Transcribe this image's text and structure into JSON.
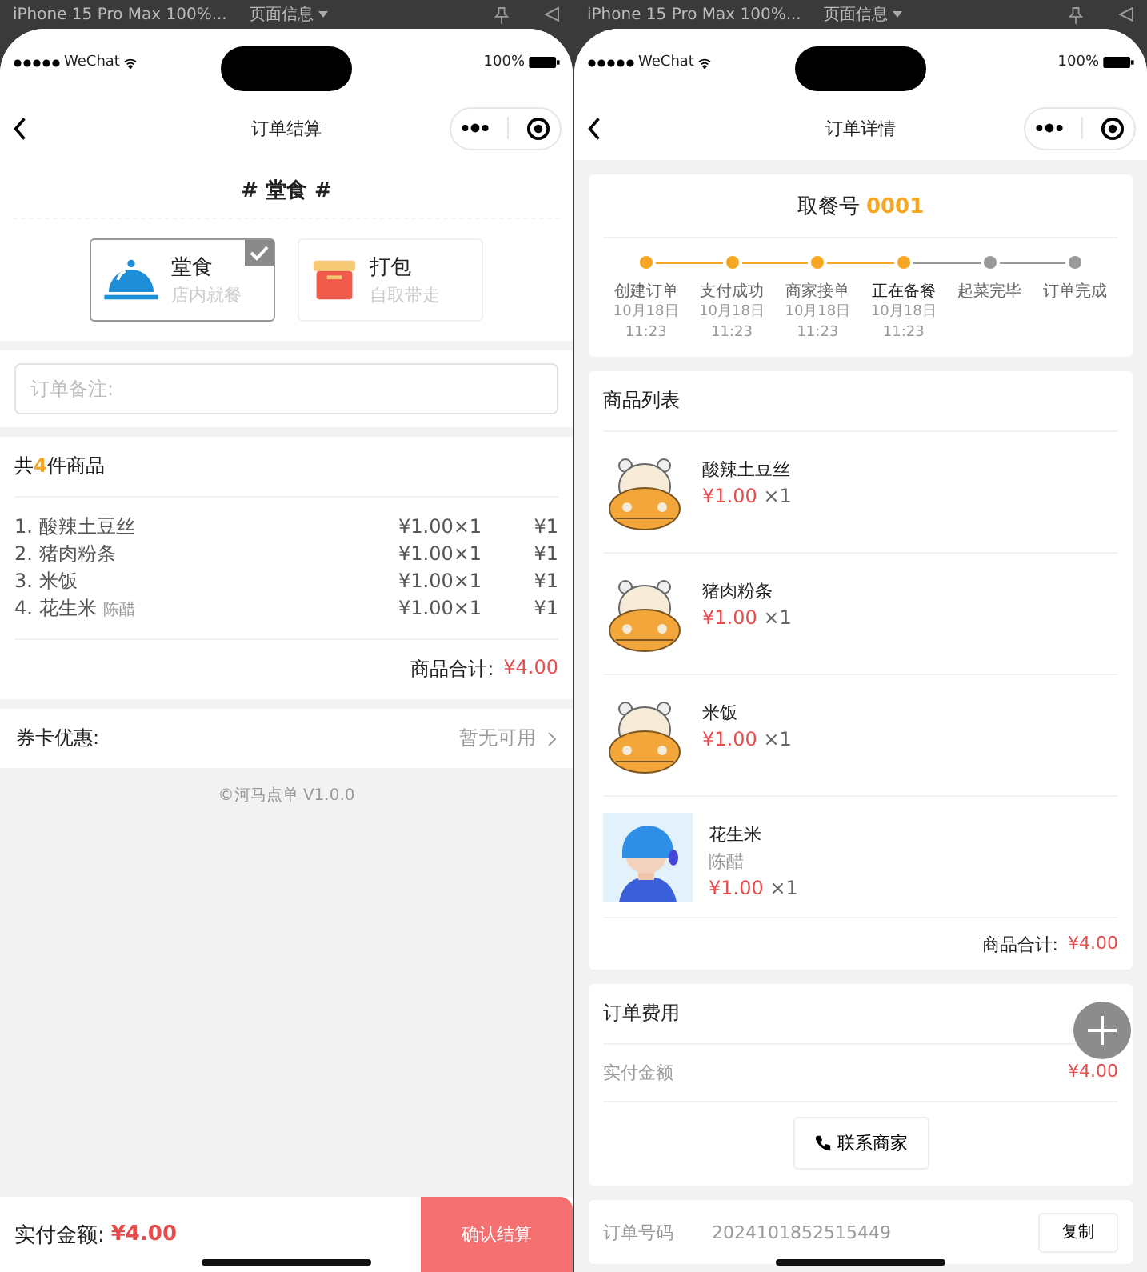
{
  "checkout": {
    "toolbar": {
      "device": "iPhone 15 Pro Max 100%...",
      "menu": "页面信息"
    },
    "status": {
      "carrier": "WeChat",
      "battery": "100%"
    },
    "nav_title": "订单结算",
    "mode_heading": "# 堂食 #",
    "modes": [
      {
        "kind": "dine",
        "title": "堂食",
        "subtitle": "店内就餐",
        "selected": true
      },
      {
        "kind": "pack",
        "title": "打包",
        "subtitle": "自取带走",
        "selected": false
      }
    ],
    "remark": {
      "placeholder": "订单备注:"
    },
    "goods": {
      "prefix": "共",
      "count": "4",
      "suffix": "件商品",
      "items": [
        {
          "index": "1.",
          "name": "酸辣土豆丝",
          "price": "¥1.00×1",
          "total": "¥1"
        },
        {
          "index": "2.",
          "name": "猪肉粉条",
          "price": "¥1.00×1",
          "total": "¥1"
        },
        {
          "index": "3.",
          "name": "米饭",
          "price": "¥1.00×1",
          "total": "¥1"
        },
        {
          "index": "4.",
          "name": "花生米",
          "spec": "陈醋",
          "price": "¥1.00×1",
          "total": "¥1"
        }
      ],
      "subtotal_label": "商品合计:",
      "subtotal": "¥4.00"
    },
    "coupon": {
      "label": "券卡优惠:",
      "value": "暂无可用"
    },
    "footer": "©河马点单 V1.0.0",
    "bottom": {
      "label": "实付金额:",
      "amount": "¥4.00",
      "button": "确认结算"
    }
  },
  "order_detail": {
    "toolbar": {
      "device": "iPhone 15 Pro Max 100%...",
      "menu": "页面信息"
    },
    "status": {
      "carrier": "WeChat",
      "battery": "100%"
    },
    "nav_title": "订单详情",
    "pickup": {
      "label": "取餐号",
      "number": "0001"
    },
    "steps": [
      {
        "label": "创建订单",
        "date": "10月18日",
        "time": "11:23",
        "done": true,
        "current": false
      },
      {
        "label": "支付成功",
        "date": "10月18日",
        "time": "11:23",
        "done": true,
        "current": false
      },
      {
        "label": "商家接单",
        "date": "10月18日",
        "time": "11:23",
        "done": true,
        "current": false
      },
      {
        "label": "正在备餐",
        "date": "10月18日",
        "time": "11:23",
        "done": true,
        "current": true
      },
      {
        "label": "起菜完毕",
        "done": false,
        "current": false
      },
      {
        "label": "订单完成",
        "done": false,
        "current": false
      }
    ],
    "goods_title": "商品列表",
    "items": [
      {
        "kind": "hippo",
        "name": "酸辣土豆丝",
        "price": "¥1.00",
        "qty": "×1"
      },
      {
        "kind": "hippo",
        "name": "猪肉粉条",
        "price": "¥1.00",
        "qty": "×1"
      },
      {
        "kind": "hippo",
        "name": "米饭",
        "price": "¥1.00",
        "qty": "×1"
      },
      {
        "kind": "figure",
        "name": "花生米",
        "spec": "陈醋",
        "price": "¥1.00",
        "qty": "×1"
      }
    ],
    "subtotal_label": "商品合计:",
    "subtotal": "¥4.00",
    "fees_title": "订单费用",
    "fees": [
      {
        "label": "实付金额",
        "value": "¥4.00"
      }
    ],
    "contact_button": "联系商家",
    "order_no": {
      "label": "订单号码",
      "value": "2024101852515449",
      "button": "复制"
    }
  }
}
